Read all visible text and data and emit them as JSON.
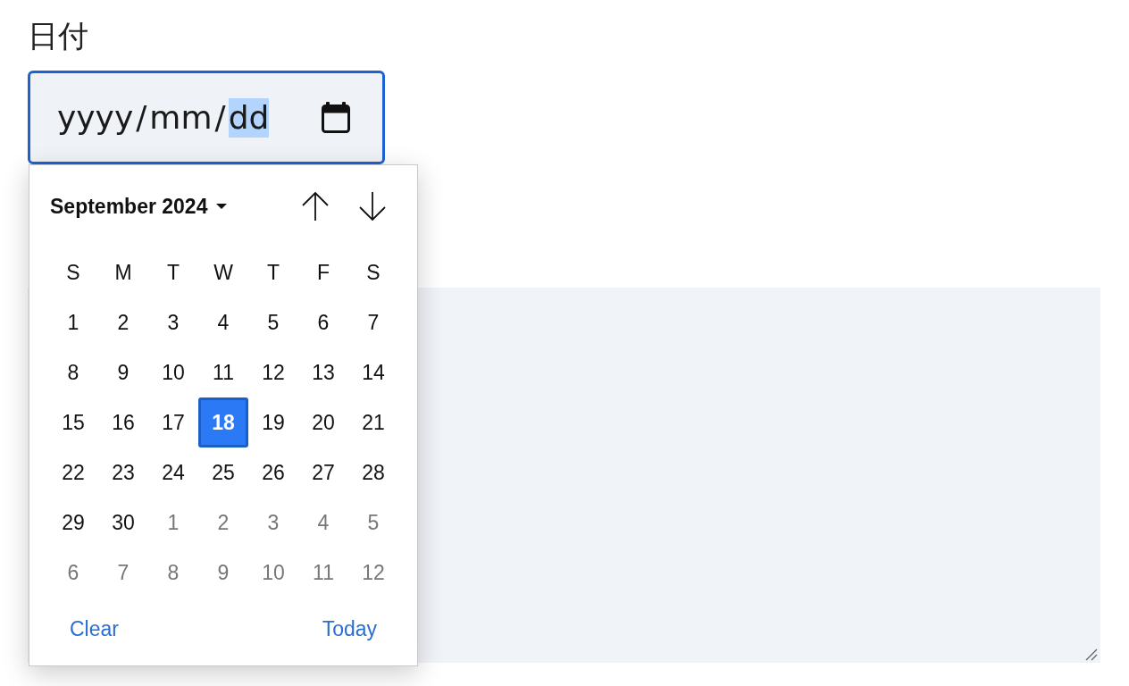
{
  "field_label": "日付",
  "date_field": {
    "focused": true,
    "segments": [
      {
        "kind": "part",
        "text": "yyyy",
        "selected": false
      },
      {
        "kind": "separator",
        "text": "/",
        "selected": false
      },
      {
        "kind": "part",
        "text": "mm",
        "selected": false
      },
      {
        "kind": "separator",
        "text": "/",
        "selected": false
      },
      {
        "kind": "part",
        "text": "dd",
        "selected": true
      }
    ]
  },
  "calendar": {
    "month_label": "September 2024",
    "weekdays": [
      "S",
      "M",
      "T",
      "W",
      "T",
      "F",
      "S"
    ],
    "weeks": [
      [
        {
          "day": "1",
          "other_month": false,
          "selected": false
        },
        {
          "day": "2",
          "other_month": false,
          "selected": false
        },
        {
          "day": "3",
          "other_month": false,
          "selected": false
        },
        {
          "day": "4",
          "other_month": false,
          "selected": false
        },
        {
          "day": "5",
          "other_month": false,
          "selected": false
        },
        {
          "day": "6",
          "other_month": false,
          "selected": false
        },
        {
          "day": "7",
          "other_month": false,
          "selected": false
        }
      ],
      [
        {
          "day": "8",
          "other_month": false,
          "selected": false
        },
        {
          "day": "9",
          "other_month": false,
          "selected": false
        },
        {
          "day": "10",
          "other_month": false,
          "selected": false
        },
        {
          "day": "11",
          "other_month": false,
          "selected": false
        },
        {
          "day": "12",
          "other_month": false,
          "selected": false
        },
        {
          "day": "13",
          "other_month": false,
          "selected": false
        },
        {
          "day": "14",
          "other_month": false,
          "selected": false
        }
      ],
      [
        {
          "day": "15",
          "other_month": false,
          "selected": false
        },
        {
          "day": "16",
          "other_month": false,
          "selected": false
        },
        {
          "day": "17",
          "other_month": false,
          "selected": false
        },
        {
          "day": "18",
          "other_month": false,
          "selected": true
        },
        {
          "day": "19",
          "other_month": false,
          "selected": false
        },
        {
          "day": "20",
          "other_month": false,
          "selected": false
        },
        {
          "day": "21",
          "other_month": false,
          "selected": false
        }
      ],
      [
        {
          "day": "22",
          "other_month": false,
          "selected": false
        },
        {
          "day": "23",
          "other_month": false,
          "selected": false
        },
        {
          "day": "24",
          "other_month": false,
          "selected": false
        },
        {
          "day": "25",
          "other_month": false,
          "selected": false
        },
        {
          "day": "26",
          "other_month": false,
          "selected": false
        },
        {
          "day": "27",
          "other_month": false,
          "selected": false
        },
        {
          "day": "28",
          "other_month": false,
          "selected": false
        }
      ],
      [
        {
          "day": "29",
          "other_month": false,
          "selected": false
        },
        {
          "day": "30",
          "other_month": false,
          "selected": false
        },
        {
          "day": "1",
          "other_month": true,
          "selected": false
        },
        {
          "day": "2",
          "other_month": true,
          "selected": false
        },
        {
          "day": "3",
          "other_month": true,
          "selected": false
        },
        {
          "day": "4",
          "other_month": true,
          "selected": false
        },
        {
          "day": "5",
          "other_month": true,
          "selected": false
        }
      ],
      [
        {
          "day": "6",
          "other_month": true,
          "selected": false
        },
        {
          "day": "7",
          "other_month": true,
          "selected": false
        },
        {
          "day": "8",
          "other_month": true,
          "selected": false
        },
        {
          "day": "9",
          "other_month": true,
          "selected": false
        },
        {
          "day": "10",
          "other_month": true,
          "selected": false
        },
        {
          "day": "11",
          "other_month": true,
          "selected": false
        },
        {
          "day": "12",
          "other_month": true,
          "selected": false
        }
      ]
    ],
    "buttons": [
      "Clear",
      "Today"
    ]
  },
  "text_area": {
    "resizable": true
  }
}
